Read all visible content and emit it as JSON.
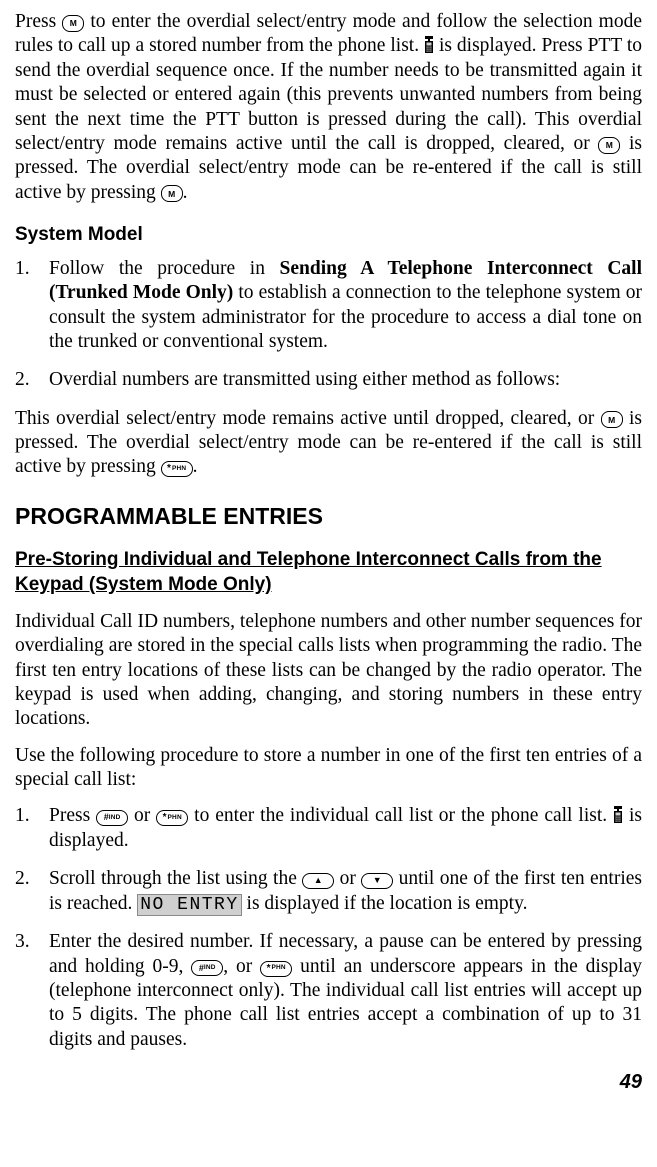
{
  "para1": {
    "t1": "Press ",
    "t2": " to enter the overdial select/entry mode and follow the selection mode rules to call up a stored number from the phone list. ",
    "t3": " is displayed. Press PTT to send the overdial sequence once. If the number needs to be transmitted again it must be selected or entered again (this prevents unwanted numbers from being sent the next time the PTT button is pressed during the call). This overdial select/entry mode remains active until the call is dropped, cleared, or ",
    "t4": " is pressed. The overdial select/entry mode can be re-entered if the call is still active by pressing ",
    "t5": "."
  },
  "section1_title": "System Model",
  "ol1": {
    "n1": "1.",
    "i1a": "Follow the procedure in ",
    "i1b": "Sending A Telephone Interconnect Call (Trunked Mode Only)",
    "i1c": " to establish a connection to the telephone system or consult the system administrator for the procedure to access a dial tone on the trunked or conventional system.",
    "n2": "2.",
    "i2": "Overdial numbers are transmitted using either method as follows:"
  },
  "para2": {
    "t1": "This overdial select/entry mode remains active until dropped, cleared, or ",
    "t2": " is pressed. The overdial select/entry mode can be re-entered if the call is still active by pressing ",
    "t3": "."
  },
  "main_title": "PROGRAMMABLE ENTRIES",
  "sub_title": "Pre-Storing Individual and Telephone Interconnect Calls from the Keypad (System Mode Only)",
  "para3": "Individual Call ID numbers, telephone numbers and other number sequences for overdialing are stored in the special calls lists when programming the radio. The first ten entry locations of these lists can be changed by the radio operator. The keypad is used when adding, changing, and storing numbers in these entry locations.",
  "para4": "Use the following procedure to store a number in one of the first ten entries of a special call list:",
  "ol2": {
    "n1": "1.",
    "i1a": "Press ",
    "i1b": " or ",
    "i1c": " to enter the individual call list or the phone call list. ",
    "i1d": " is displayed.",
    "n2": "2.",
    "i2a": "Scroll through the list using the ",
    "i2b": " or ",
    "i2c": " until one of the first ten entries is reached. ",
    "i2d": " is displayed if the location is empty.",
    "lcd": "NO ENTRY",
    "n3": "3.",
    "i3a": "Enter the desired number. If necessary, a pause can be entered by pressing and holding 0-9, ",
    "i3b": ", or ",
    "i3c": " until an underscore appears in the display (telephone interconnect only). The individual call list entries will accept up to 5 digits. The phone call list entries accept a combination of up to 31 digits and pauses."
  },
  "keys": {
    "m": "M",
    "star": "*",
    "hash": "#",
    "phn": "PHN",
    "ind": "IND",
    "up": "▲",
    "down": "▼"
  },
  "page_number": "49"
}
